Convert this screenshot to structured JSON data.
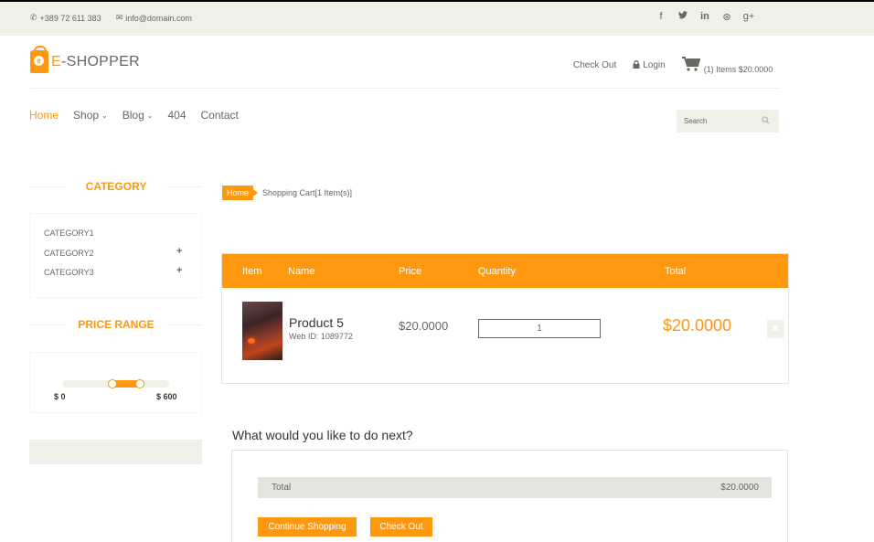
{
  "topbar": {
    "phone": "+389 72 611 383",
    "email": "info@domain.com",
    "social": [
      {
        "icon": "facebook-icon",
        "glyph": "f"
      },
      {
        "icon": "twitter-icon",
        "glyph": "🐦"
      },
      {
        "icon": "linkedin-icon",
        "glyph": "in"
      },
      {
        "icon": "dribbble-icon",
        "glyph": "⊛"
      },
      {
        "icon": "google-plus-icon",
        "glyph": "g+"
      }
    ]
  },
  "header": {
    "logo_letter": "e",
    "brand_first": "E",
    "brand_rest": "-SHOPPER",
    "checkout": "Check Out",
    "login": "Login",
    "cart_text": "(1) Items $20.0000"
  },
  "nav": {
    "items": [
      "Home",
      "Shop",
      "Blog",
      "404",
      "Contact"
    ],
    "search_placeholder": "Search"
  },
  "sidebar": {
    "category_title": "CATEGORY",
    "categories": [
      "CATEGORY1",
      "CATEGORY2",
      "CATEGORY3"
    ],
    "price_title": "PRICE RANGE",
    "price_min": "$ 0",
    "price_max": "$ 600"
  },
  "breadcrumb": {
    "home": "Home",
    "current": "Shopping Cart[1 Item(s)]"
  },
  "cart": {
    "headers": [
      "Item",
      "Name",
      "Price",
      "Quantity",
      "Total"
    ],
    "product_name": "Product 5",
    "web_id": "Web ID: 1089772",
    "price": "$20.0000",
    "quantity": "1",
    "total": "$20.0000",
    "delete_glyph": "✖"
  },
  "next": {
    "title": "What would you like to do next?",
    "total_label": "Total",
    "total_value": "$20.0000",
    "continue_label": "Continue Shopping",
    "checkout_label": "Check Out"
  },
  "colors": {
    "accent": "#fe980f",
    "bar": "#f0f0e9",
    "text": "#696763"
  }
}
